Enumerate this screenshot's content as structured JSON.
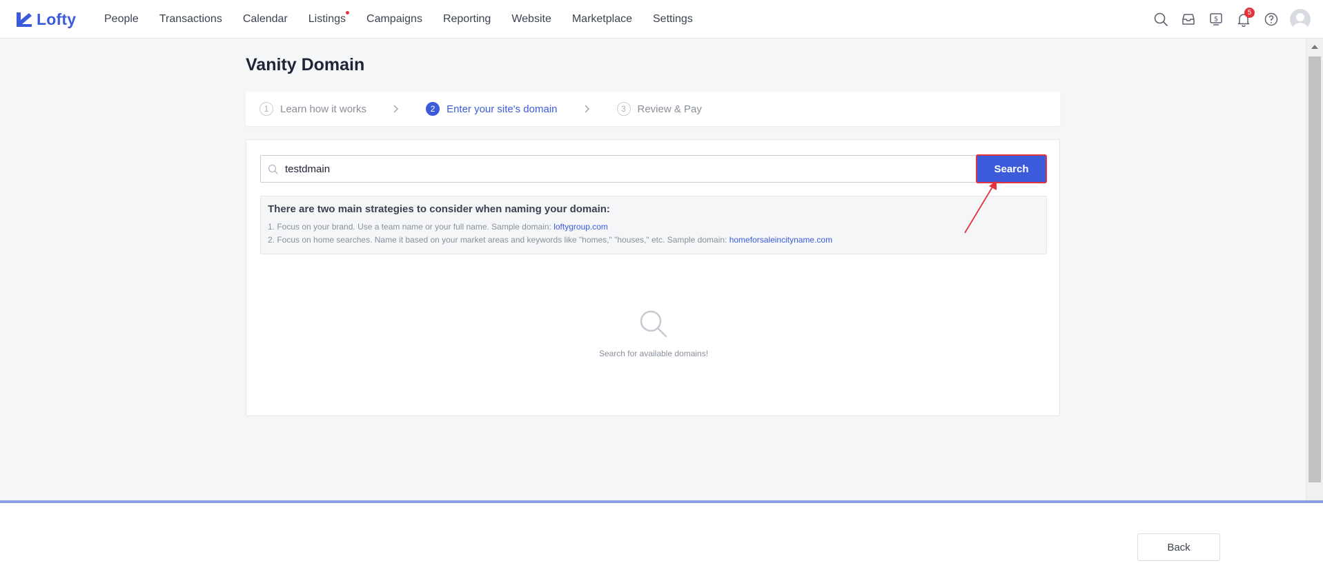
{
  "app": {
    "logo_text": "Lofty",
    "brand_color": "#3b5bdb"
  },
  "nav": {
    "items": [
      {
        "label": "People"
      },
      {
        "label": "Transactions"
      },
      {
        "label": "Calendar"
      },
      {
        "label": "Listings",
        "dot": true
      },
      {
        "label": "Campaigns"
      },
      {
        "label": "Reporting"
      },
      {
        "label": "Website"
      },
      {
        "label": "Marketplace"
      },
      {
        "label": "Settings"
      }
    ],
    "icons": [
      "search-icon",
      "inbox-icon",
      "billing-icon",
      "bell-icon",
      "help-icon",
      "avatar"
    ],
    "notification_count": "5"
  },
  "page": {
    "title": "Vanity Domain"
  },
  "steps": [
    {
      "num": "1",
      "label": "Learn how it works",
      "state": "done"
    },
    {
      "num": "2",
      "label": "Enter your site's domain",
      "state": "active"
    },
    {
      "num": "3",
      "label": "Review & Pay",
      "state": "pending"
    }
  ],
  "search": {
    "value": "testdmain",
    "button_label": "Search"
  },
  "tips": {
    "title": "There are two main strategies to consider when naming your domain:",
    "line1_text": "1. Focus on your brand. Use a team name or your full name. Sample domain: ",
    "line1_link": "loftygroup.com",
    "line2_text": "2. Focus on home searches. Name it based on your market areas and keywords like \"homes,\" \"houses,\" etc. Sample domain: ",
    "line2_link": "homeforsaleincityname.com"
  },
  "empty_state": {
    "text": "Search for available domains!"
  },
  "footer": {
    "back_label": "Back"
  }
}
